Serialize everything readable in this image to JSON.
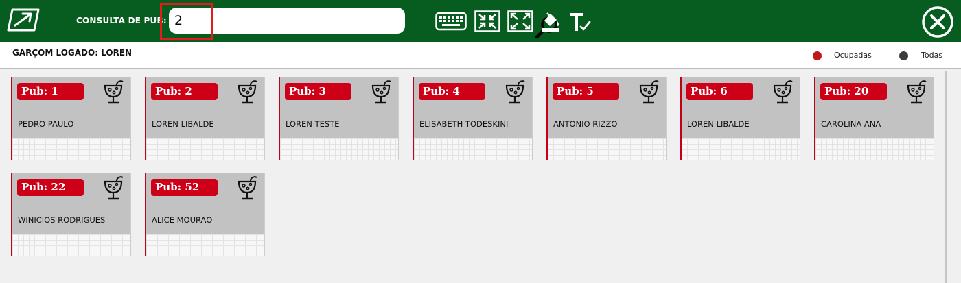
{
  "header": {
    "search_label": "CONSULTA DE PUB:",
    "search_value": "2",
    "icons": [
      "logo-icon",
      "search-icon",
      "keyboard-icon",
      "compress-icon",
      "expand-icon",
      "fill-color-icon",
      "text-format-icon",
      "close-icon"
    ]
  },
  "status": {
    "waiter_label": "GARÇOM LOGADO: LOREN",
    "legend": [
      {
        "label": "Ocupadas",
        "color": "#c0171e"
      },
      {
        "label": "Todas",
        "color": "#3c3c3c"
      }
    ]
  },
  "colors": {
    "header_bg": "#075c1f",
    "badge_bg": "#cd0018",
    "card_bg": "#c2c2c2",
    "highlight": "#e51b1b"
  },
  "pubs": [
    {
      "label": "Pub: 1",
      "name": "PEDRO PAULO"
    },
    {
      "label": "Pub: 2",
      "name": "LOREN LIBALDE"
    },
    {
      "label": "Pub: 3",
      "name": "LOREN TESTE"
    },
    {
      "label": "Pub: 4",
      "name": "ELISABETH TODESKINI"
    },
    {
      "label": "Pub: 5",
      "name": "ANTONIO RIZZO"
    },
    {
      "label": "Pub: 6",
      "name": "LOREN LIBALDE"
    },
    {
      "label": "Pub: 20",
      "name": "CAROLINA ANA"
    },
    {
      "label": "Pub: 22",
      "name": "WINICIOS RODRIGUES"
    },
    {
      "label": "Pub: 52",
      "name": "ALICE MOURAO"
    }
  ]
}
